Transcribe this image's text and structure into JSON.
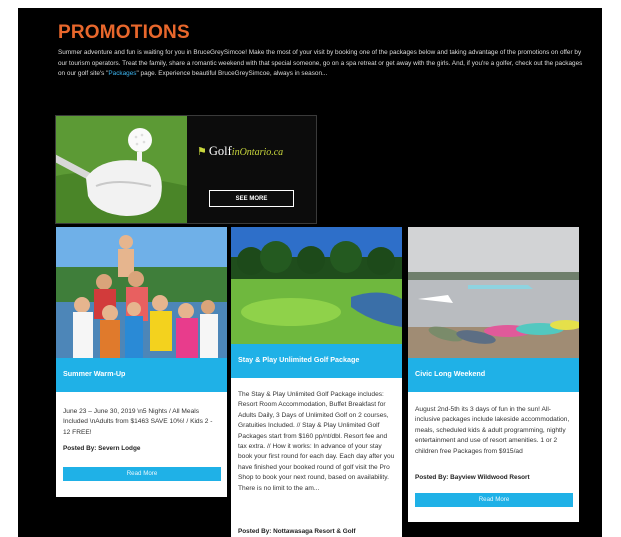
{
  "page": {
    "title": "PROMOTIONS",
    "intro_before_link": "Summer adventure and fun is waiting for you in BruceGreySimcoe! Make the most of your visit by booking one of the packages below and taking advantage of the promotions on offer by our tourism operators. Treat the family, share a romantic weekend with that special someone, go on a spa retreat or get away with the girls. And, if you're a golfer, check out the packages on our golf site's \"",
    "intro_link": "Packages",
    "intro_after_link": "\" page. Experience beautiful BruceGreySimcoe, always in season..."
  },
  "banner": {
    "logo_part1": "Golf",
    "logo_part2": "inOntario.ca",
    "logo_on": "on",
    "button_label": "SEE MORE"
  },
  "cards": [
    {
      "title": "Summer Warm-Up",
      "body": "June 23 – June 30, 2019 \\n5 Nights / All Meals Included \\nAdults from $1463 SAVE 10%! / Kids 2 - 12 FREE!",
      "posted_by": "Posted By: Severn Lodge",
      "button_label": "Read More"
    },
    {
      "title": "Stay & Play Unlimited Golf Package",
      "body": "The Stay & Play Unlimited Golf Package includes: Resort Room Accommodation, Buffet Breakfast for Adults Daily, 3 Days of Unlimited Golf on 2 courses, Gratuities Included. // Stay & Play Unlimited Golf Packages start from $160 pp/nt/dbl. Resort fee and tax extra. // How it works: In advance of your stay book your first round for each day. Each day after you have finished your booked round of golf visit the Pro Shop to book your next round, based on availability. There is no limit to the am...",
      "posted_by": "Posted By: Nottawasaga Resort & Golf",
      "button_label": ""
    },
    {
      "title": "Civic Long Weekend",
      "body": "August 2nd-5th its 3 days of fun in the sun! All-inclusive packages include lakeside accommodation, meals, scheduled kids & adult programming, nightly entertainment and use of resort amenities. 1 or 2 children free Packages from $915/ad",
      "posted_by": "Posted By: Bayview Wildwood Resort",
      "button_label": "Read More"
    }
  ],
  "colors": {
    "accent_orange": "#e8672c",
    "accent_blue": "#1fb1e7",
    "background": "#000000"
  }
}
